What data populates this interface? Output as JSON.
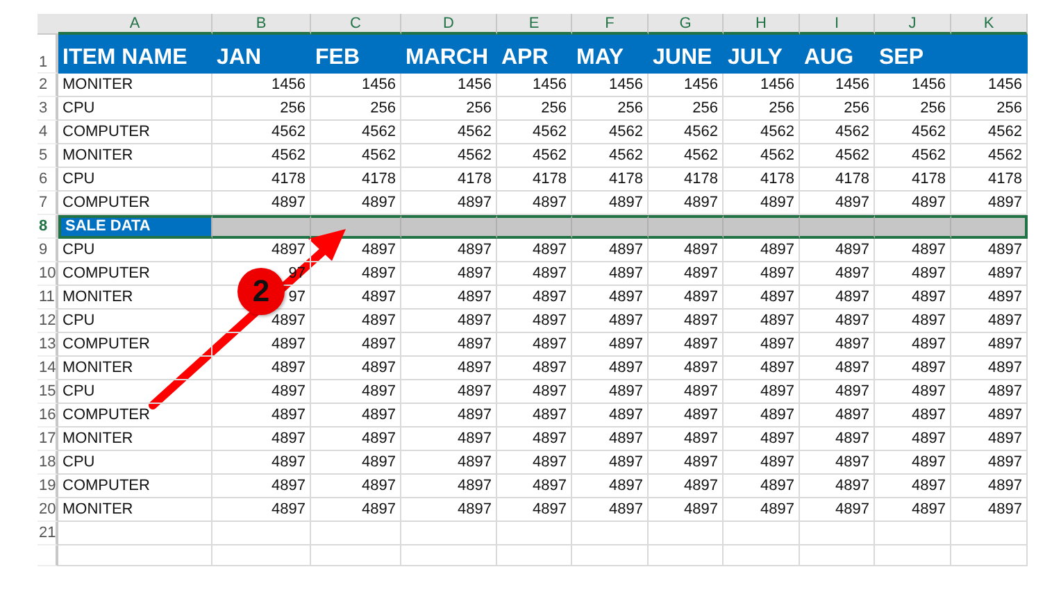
{
  "column_letters": [
    "A",
    "B",
    "C",
    "D",
    "E",
    "F",
    "G",
    "H",
    "I",
    "J",
    "K"
  ],
  "header_row": {
    "number": "1",
    "cells": [
      "ITEM NAME",
      "JAN",
      "FEB",
      "MARCH",
      "APR",
      "MAY",
      "JUNE",
      "JULY",
      "AUG",
      "SEP",
      ""
    ]
  },
  "rows": [
    {
      "number": "2",
      "name": "MONITER",
      "values": [
        "1456",
        "1456",
        "1456",
        "1456",
        "1456",
        "1456",
        "1456",
        "1456",
        "1456",
        "1456"
      ],
      "selected": false
    },
    {
      "number": "3",
      "name": "CPU",
      "values": [
        "256",
        "256",
        "256",
        "256",
        "256",
        "256",
        "256",
        "256",
        "256",
        "256"
      ],
      "selected": false
    },
    {
      "number": "4",
      "name": "COMPUTER",
      "values": [
        "4562",
        "4562",
        "4562",
        "4562",
        "4562",
        "4562",
        "4562",
        "4562",
        "4562",
        "4562"
      ],
      "selected": false
    },
    {
      "number": "5",
      "name": "MONITER",
      "values": [
        "4562",
        "4562",
        "4562",
        "4562",
        "4562",
        "4562",
        "4562",
        "4562",
        "4562",
        "4562"
      ],
      "selected": false
    },
    {
      "number": "6",
      "name": "CPU",
      "values": [
        "4178",
        "4178",
        "4178",
        "4178",
        "4178",
        "4178",
        "4178",
        "4178",
        "4178",
        "4178"
      ],
      "selected": false
    },
    {
      "number": "7",
      "name": "COMPUTER",
      "values": [
        "4897",
        "4897",
        "4897",
        "4897",
        "4897",
        "4897",
        "4897",
        "4897",
        "4897",
        "4897"
      ],
      "selected": false
    },
    {
      "number": "8",
      "name": "SALE DATA",
      "selected": true
    },
    {
      "number": "9",
      "name": "CPU",
      "values": [
        "4897",
        "4897",
        "4897",
        "4897",
        "4897",
        "4897",
        "4897",
        "4897",
        "4897",
        "4897"
      ],
      "selected": false
    },
    {
      "number": "10",
      "name": "COMPUTER",
      "values": [
        "97",
        "4897",
        "4897",
        "4897",
        "4897",
        "4897",
        "4897",
        "4897",
        "4897",
        "4897"
      ],
      "selected": false
    },
    {
      "number": "11",
      "name": "MONITER",
      "values": [
        "97",
        "4897",
        "4897",
        "4897",
        "4897",
        "4897",
        "4897",
        "4897",
        "4897",
        "4897"
      ],
      "selected": false
    },
    {
      "number": "12",
      "name": "CPU",
      "values": [
        "4897",
        "4897",
        "4897",
        "4897",
        "4897",
        "4897",
        "4897",
        "4897",
        "4897",
        "4897"
      ],
      "selected": false
    },
    {
      "number": "13",
      "name": "COMPUTER",
      "values": [
        "4897",
        "4897",
        "4897",
        "4897",
        "4897",
        "4897",
        "4897",
        "4897",
        "4897",
        "4897"
      ],
      "selected": false
    },
    {
      "number": "14",
      "name": "MONITER",
      "values": [
        "4897",
        "4897",
        "4897",
        "4897",
        "4897",
        "4897",
        "4897",
        "4897",
        "4897",
        "4897"
      ],
      "selected": false
    },
    {
      "number": "15",
      "name": "CPU",
      "values": [
        "4897",
        "4897",
        "4897",
        "4897",
        "4897",
        "4897",
        "4897",
        "4897",
        "4897",
        "4897"
      ],
      "selected": false
    },
    {
      "number": "16",
      "name": "COMPUTER",
      "values": [
        "4897",
        "4897",
        "4897",
        "4897",
        "4897",
        "4897",
        "4897",
        "4897",
        "4897",
        "4897"
      ],
      "selected": false
    },
    {
      "number": "17",
      "name": "MONITER",
      "values": [
        "4897",
        "4897",
        "4897",
        "4897",
        "4897",
        "4897",
        "4897",
        "4897",
        "4897",
        "4897"
      ],
      "selected": false
    },
    {
      "number": "18",
      "name": "CPU",
      "values": [
        "4897",
        "4897",
        "4897",
        "4897",
        "4897",
        "4897",
        "4897",
        "4897",
        "4897",
        "4897"
      ],
      "selected": false
    },
    {
      "number": "19",
      "name": "COMPUTER",
      "values": [
        "4897",
        "4897",
        "4897",
        "4897",
        "4897",
        "4897",
        "4897",
        "4897",
        "4897",
        "4897"
      ],
      "selected": false
    },
    {
      "number": "20",
      "name": "MONITER",
      "values": [
        "4897",
        "4897",
        "4897",
        "4897",
        "4897",
        "4897",
        "4897",
        "4897",
        "4897",
        "4897"
      ],
      "selected": false
    },
    {
      "number": "21",
      "selected": false
    }
  ],
  "annotation": {
    "badge": "2"
  }
}
